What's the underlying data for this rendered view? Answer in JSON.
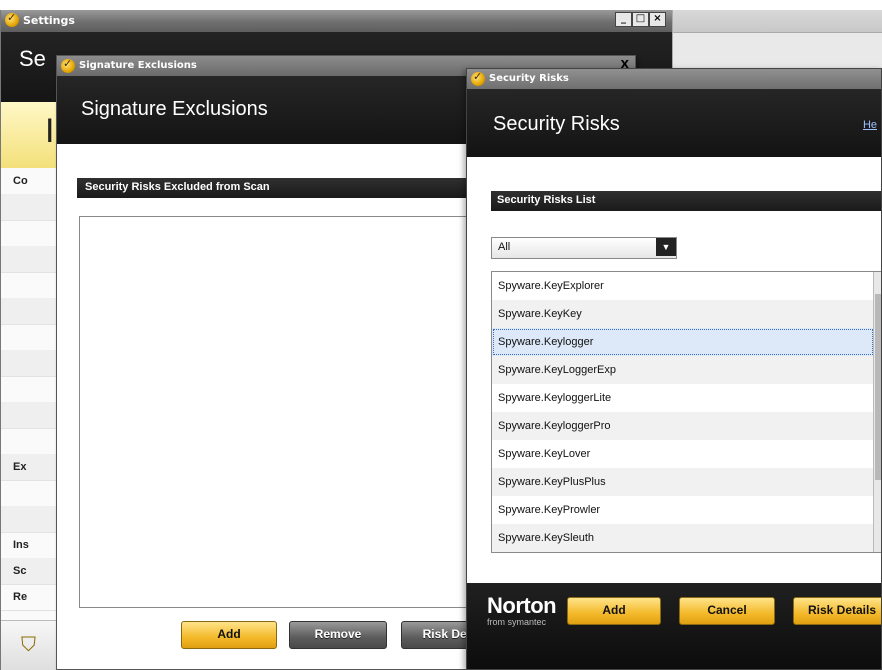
{
  "settings_window": {
    "title": "Settings",
    "min_label": "_",
    "max_label": "□",
    "close_label": "×",
    "header_title": "Se",
    "stripe_glyph": "I",
    "nav": [
      {
        "label": "Co"
      },
      {
        "label": ""
      },
      {
        "label": ""
      },
      {
        "label": ""
      },
      {
        "label": ""
      },
      {
        "label": ""
      },
      {
        "label": ""
      },
      {
        "label": ""
      },
      {
        "label": ""
      },
      {
        "label": ""
      },
      {
        "label": ""
      },
      {
        "label": "Ex"
      },
      {
        "label": ""
      },
      {
        "label": ""
      },
      {
        "label": "Ins"
      },
      {
        "label": "Sc"
      },
      {
        "label": "Re"
      }
    ],
    "next_glyph": "▶"
  },
  "sigex_window": {
    "title": "Signature Exclusions",
    "close_label": "X",
    "header_title": "Signature Exclusions",
    "section_label": "Security Risks Excluded from Scan",
    "add_label": "Add",
    "remove_label": "Remove",
    "risk_details_label": "Risk Deta"
  },
  "security_risks_window": {
    "title": "Security Risks",
    "header_title": "Security Risks",
    "help_label": "He",
    "section_label": "Security Risks List",
    "filter_value": "All",
    "items": [
      "Spyware.KeyExplorer",
      "Spyware.KeyKey",
      "Spyware.Keylogger",
      "Spyware.KeyLoggerExp",
      "Spyware.KeyloggerLite",
      "Spyware.KeyloggerPro",
      "Spyware.KeyLover",
      "Spyware.KeyPlusPlus",
      "Spyware.KeyProwler",
      "Spyware.KeySleuth"
    ],
    "selected_index": 2,
    "brand": "Norton",
    "brand_sub": "from symantec",
    "add_label": "Add",
    "cancel_label": "Cancel",
    "risk_details_label": "Risk Details"
  },
  "colors": {
    "accent_yellow": "#f3b92a",
    "header_dark": "#1a1a1a",
    "selection": "#dde9f8"
  }
}
